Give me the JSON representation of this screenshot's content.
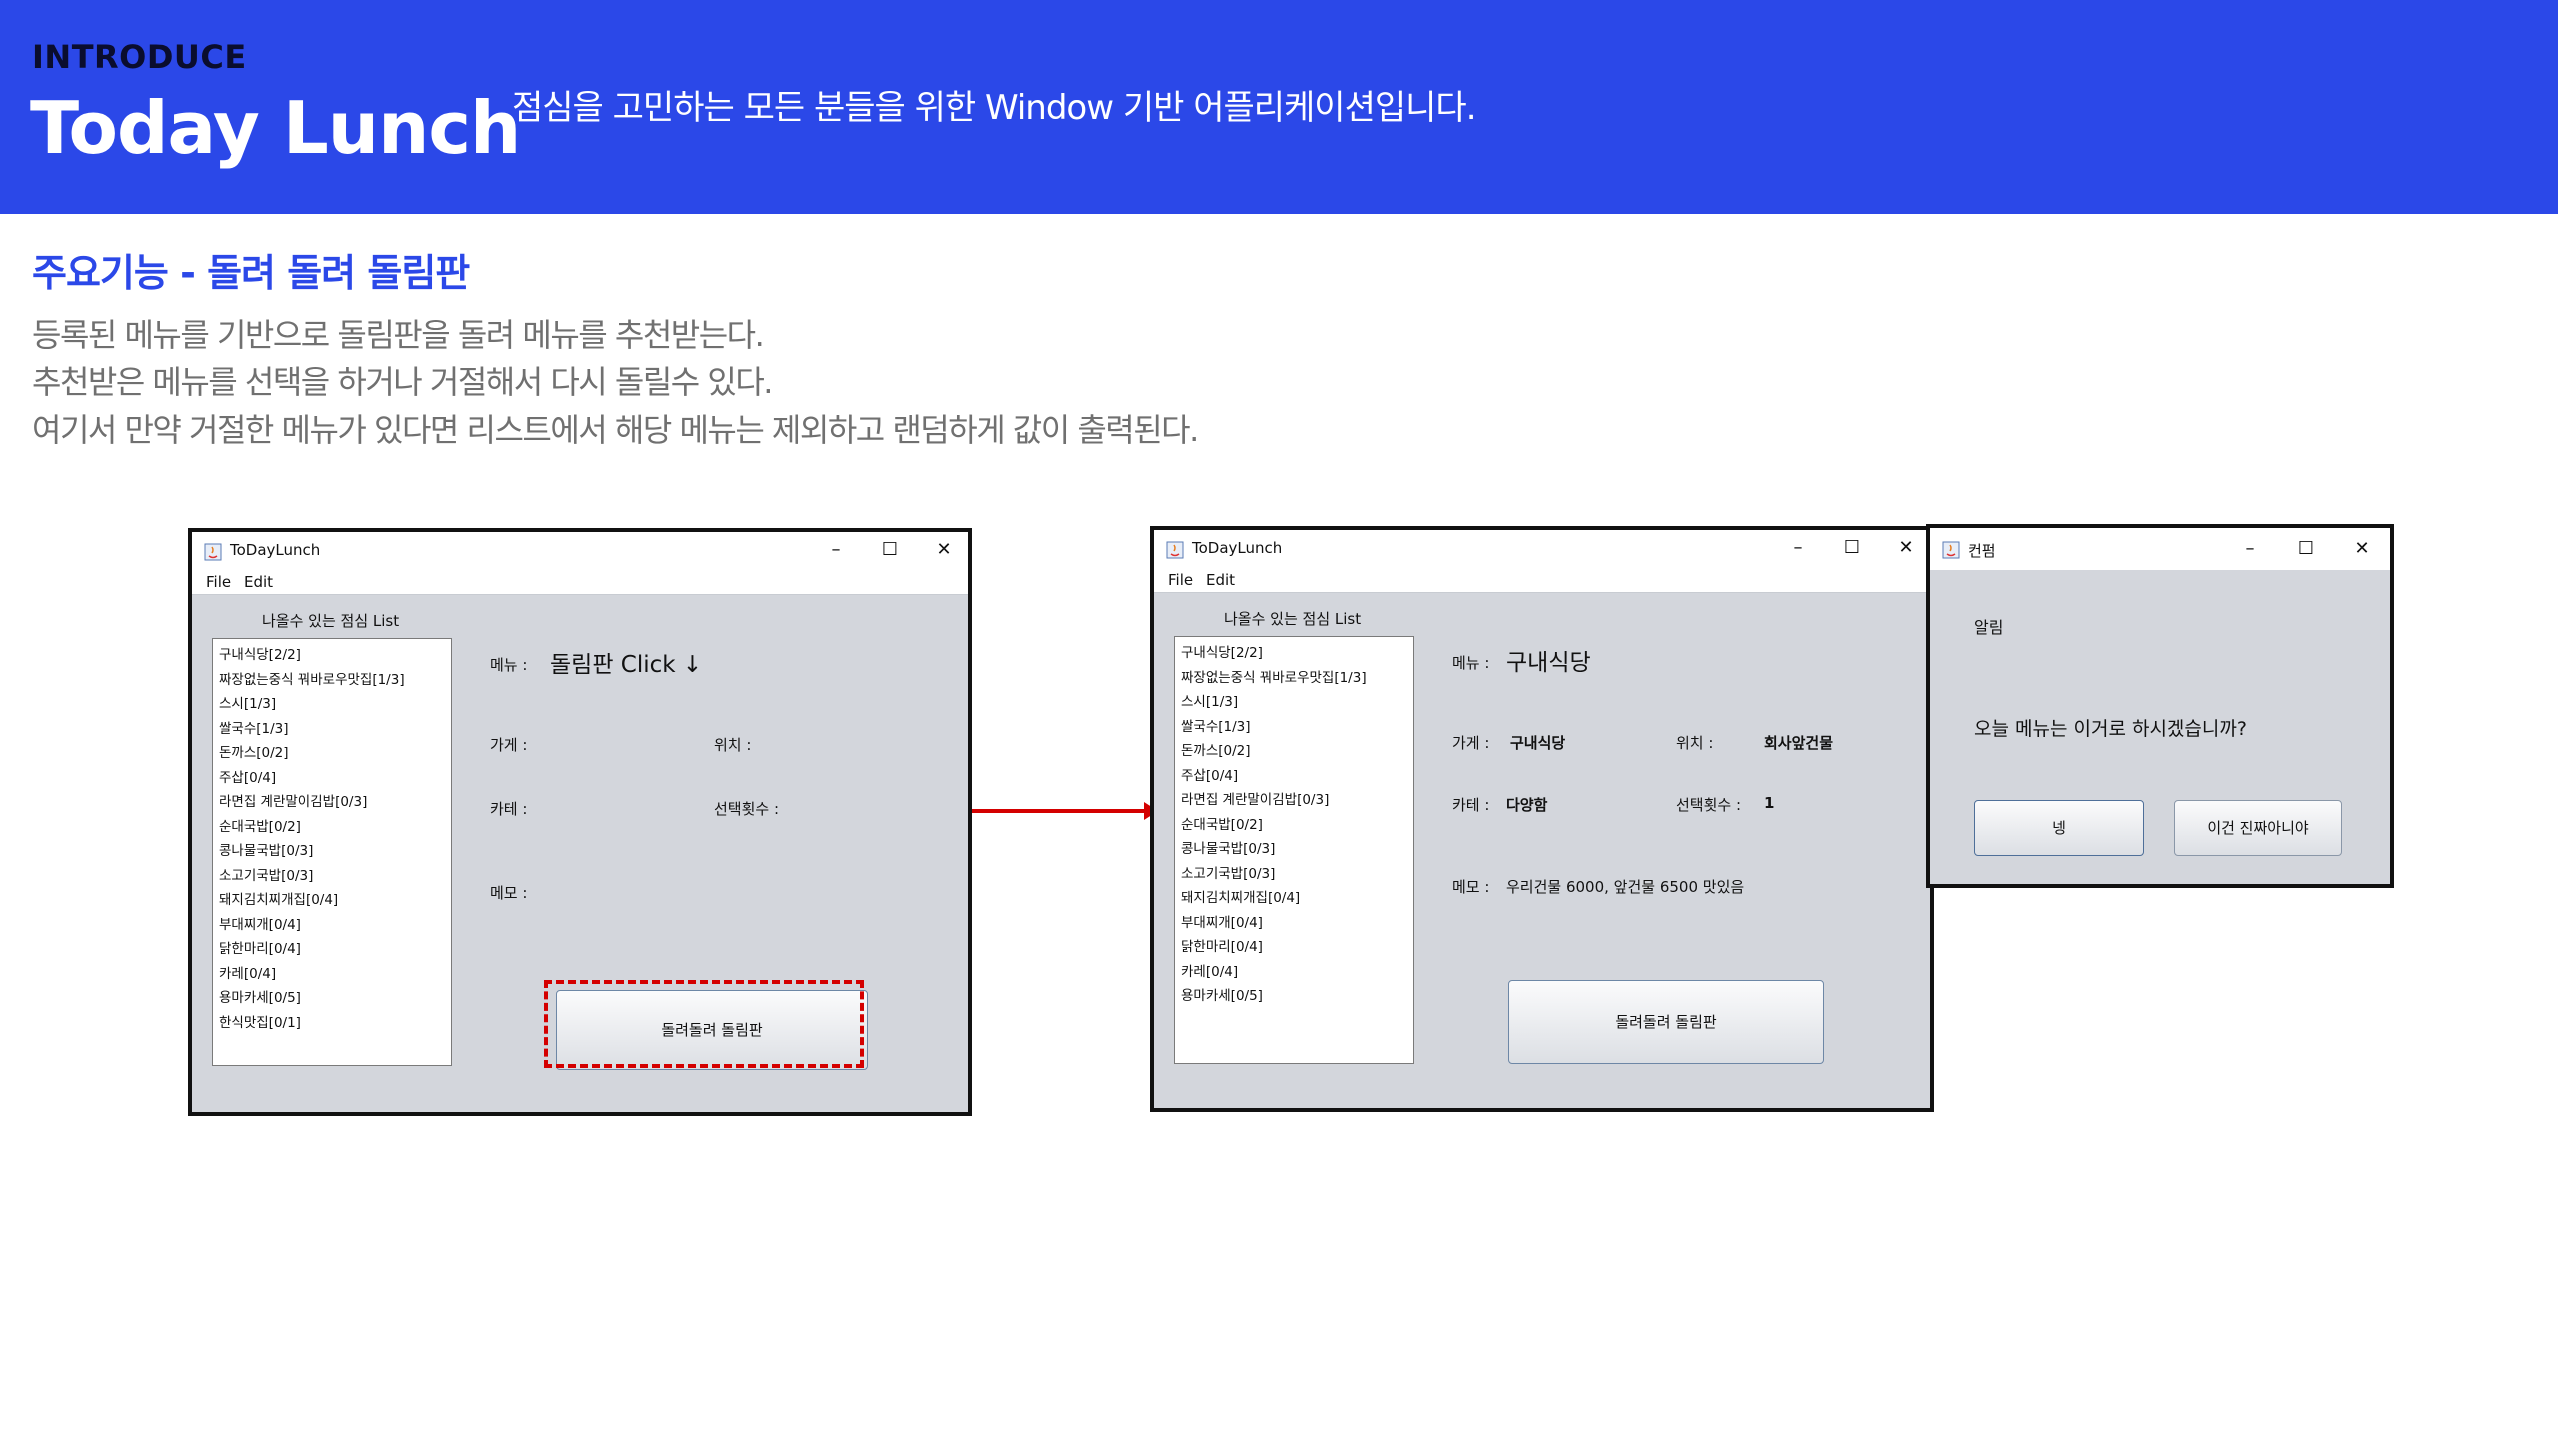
{
  "header": {
    "tag": "INTRODUCE",
    "title": "Today Lunch",
    "subtitle": "점심을 고민하는 모든 분들을 위한 Window 기반 어플리케이션입니다."
  },
  "section": {
    "title": "주요기능 - 돌려 돌려 돌림판",
    "lines": [
      "등록된 메뉴를 기반으로 돌림판을 돌려 메뉴를 추천받는다.",
      "추천받은 메뉴를 선택을 하거나 거절해서 다시 돌릴수 있다.",
      "여기서 만약 거절한 메뉴가 있다면 리스트에서 해당 메뉴는 제외하고 랜덤하게 값이 출력된다."
    ]
  },
  "colors": {
    "brand": "#2b48e8",
    "annotation": "#d40000",
    "window_bg": "#d3d6dc"
  },
  "window1": {
    "title": "ToDayLunch",
    "menu": [
      "File",
      "Edit"
    ],
    "list_label": "나올수 있는 점심 List",
    "items": [
      "구내식당[2/2]",
      "짜장없는중식 꿔바로우맛집[1/3]",
      "스시[1/3]",
      "쌀국수[1/3]",
      "돈까스[0/2]",
      "주삽[0/4]",
      "라면집 계란말이김밥[0/3]",
      "순대국밥[0/2]",
      "콩나물국밥[0/3]",
      "소고기국밥[0/3]",
      "돼지김치찌개집[0/4]",
      "부대찌개[0/4]",
      "닭한마리[0/4]",
      "카레[0/4]",
      "용마카세[0/5]",
      "한식맛집[0/1]"
    ],
    "menu_label": "메뉴 :",
    "menu_value": "돌림판 Click ↓",
    "store_label": "가게 :",
    "location_label": "위치 :",
    "category_label": "카테 :",
    "count_label": "선택횟수 :",
    "memo_label": "메모 :",
    "button": "돌려돌려 돌림판"
  },
  "window2": {
    "title": "ToDayLunch",
    "menu": [
      "File",
      "Edit"
    ],
    "list_label": "나올수 있는 점심 List",
    "items": [
      "구내식당[2/2]",
      "짜장없는중식 꿔바로우맛집[1/3]",
      "스시[1/3]",
      "쌀국수[1/3]",
      "돈까스[0/2]",
      "주삽[0/4]",
      "라면집 계란말이김밥[0/3]",
      "순대국밥[0/2]",
      "콩나물국밥[0/3]",
      "소고기국밥[0/3]",
      "돼지김치찌개집[0/4]",
      "부대찌개[0/4]",
      "닭한마리[0/4]",
      "카레[0/4]",
      "용마카세[0/5]"
    ],
    "menu_label": "메뉴 :",
    "menu_value": "구내식당",
    "store_label": "가게 :",
    "store_value": "구내식당",
    "location_label": "위치 :",
    "location_value": "회사앞건물",
    "category_label": "카테 :",
    "category_value": "다양함",
    "count_label": "선택횟수 :",
    "count_value": "1",
    "memo_label": "메모 :",
    "memo_value": "우리건물 6000, 앞건물 6500 맛있음",
    "button": "돌려돌려 돌림판"
  },
  "dialog": {
    "title": "컨펌",
    "heading": "알림",
    "message": "오늘 메뉴는 이거로 하시겠습니까?",
    "yes": "넹",
    "no": "이건 진짜아니야"
  }
}
